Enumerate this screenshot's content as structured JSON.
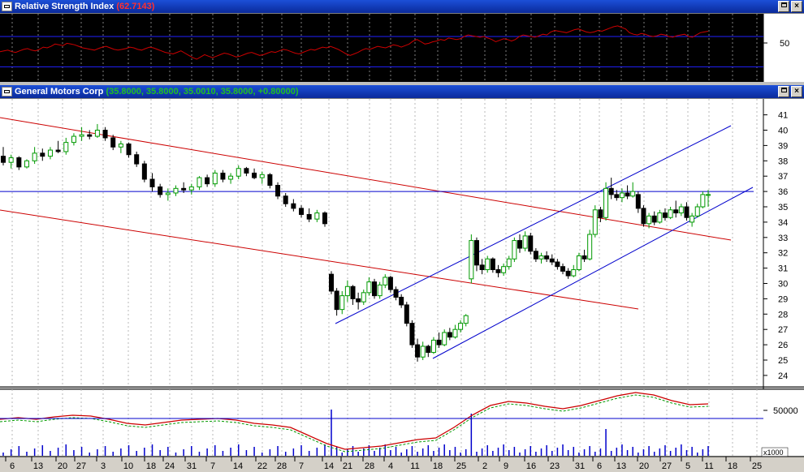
{
  "rsi_window": {
    "title": "Relative Strength Index",
    "value": "(62.7143)",
    "axis_label": "50"
  },
  "price_window": {
    "title": "General Motors Corp",
    "values": "(35.8000, 35.8000, 35.0010, 35.8000, +0.80000)"
  },
  "window_buttons": {
    "restore": "restore",
    "close": "×"
  },
  "price_axis": [
    "41",
    "40",
    "39",
    "38",
    "37",
    "36",
    "35",
    "34",
    "33",
    "32",
    "31",
    "30",
    "29",
    "28",
    "27",
    "26",
    "25",
    "24"
  ],
  "volume_axis": {
    "label": "50000",
    "multiplier": "x1000"
  },
  "date_axis": [
    "6",
    "13",
    "20",
    "27",
    "3",
    "10",
    "18",
    "24",
    "31",
    "7",
    "14",
    "22",
    "28",
    "7",
    "14",
    "21",
    "28",
    "4",
    "11",
    "18",
    "25",
    "2",
    "9",
    "16",
    "23",
    "31",
    "6",
    "13",
    "20",
    "27",
    "5",
    "11",
    "18",
    "25"
  ],
  "colors": {
    "up_candle": "#009900",
    "down_candle": "#000000",
    "channel_red": "#cc0000",
    "channel_blue": "#0000cc",
    "rsi_line": "#cc0000",
    "title_bar": "#0a2a9a"
  },
  "chart_data": {
    "type": "candlestick",
    "ylim": [
      24,
      41
    ],
    "candles": [
      {
        "o": 38.3,
        "h": 38.9,
        "l": 37.7,
        "c": 37.9
      },
      {
        "o": 37.9,
        "h": 38.4,
        "l": 37.5,
        "c": 38.2
      },
      {
        "o": 38.2,
        "h": 38.3,
        "l": 37.4,
        "c": 37.6
      },
      {
        "o": 37.6,
        "h": 38.1,
        "l": 37.5,
        "c": 38.0
      },
      {
        "o": 38.0,
        "h": 38.9,
        "l": 37.8,
        "c": 38.5
      },
      {
        "o": 38.5,
        "h": 38.8,
        "l": 38.0,
        "c": 38.3
      },
      {
        "o": 38.3,
        "h": 38.9,
        "l": 38.1,
        "c": 38.7
      },
      {
        "o": 38.7,
        "h": 39.3,
        "l": 38.5,
        "c": 38.6
      },
      {
        "o": 38.6,
        "h": 39.5,
        "l": 38.4,
        "c": 39.2
      },
      {
        "o": 39.2,
        "h": 39.8,
        "l": 39.0,
        "c": 39.6
      },
      {
        "o": 39.6,
        "h": 40.2,
        "l": 39.3,
        "c": 39.7
      },
      {
        "o": 39.7,
        "h": 40.0,
        "l": 39.4,
        "c": 39.6
      },
      {
        "o": 39.6,
        "h": 40.4,
        "l": 39.5,
        "c": 40.0
      },
      {
        "o": 40.0,
        "h": 40.2,
        "l": 39.3,
        "c": 39.5
      },
      {
        "o": 39.5,
        "h": 39.7,
        "l": 38.7,
        "c": 38.9
      },
      {
        "o": 38.9,
        "h": 39.3,
        "l": 38.5,
        "c": 39.1
      },
      {
        "o": 39.1,
        "h": 39.2,
        "l": 38.2,
        "c": 38.4
      },
      {
        "o": 38.4,
        "h": 38.6,
        "l": 37.6,
        "c": 37.8
      },
      {
        "o": 37.8,
        "h": 38.0,
        "l": 36.6,
        "c": 36.8
      },
      {
        "o": 36.8,
        "h": 37.2,
        "l": 36.0,
        "c": 36.3
      },
      {
        "o": 36.3,
        "h": 36.5,
        "l": 35.6,
        "c": 35.8
      },
      {
        "o": 35.8,
        "h": 36.2,
        "l": 35.4,
        "c": 35.9
      },
      {
        "o": 35.9,
        "h": 36.4,
        "l": 35.7,
        "c": 36.2
      },
      {
        "o": 36.2,
        "h": 36.6,
        "l": 35.9,
        "c": 36.1
      },
      {
        "o": 36.1,
        "h": 36.5,
        "l": 35.8,
        "c": 36.3
      },
      {
        "o": 36.3,
        "h": 37.0,
        "l": 36.1,
        "c": 36.9
      },
      {
        "o": 36.9,
        "h": 37.1,
        "l": 36.3,
        "c": 36.5
      },
      {
        "o": 36.5,
        "h": 37.4,
        "l": 36.3,
        "c": 37.2
      },
      {
        "o": 37.2,
        "h": 37.4,
        "l": 36.6,
        "c": 36.8
      },
      {
        "o": 36.8,
        "h": 37.2,
        "l": 36.5,
        "c": 37.0
      },
      {
        "o": 37.0,
        "h": 37.7,
        "l": 36.8,
        "c": 37.5
      },
      {
        "o": 37.5,
        "h": 37.6,
        "l": 37.0,
        "c": 37.2
      },
      {
        "o": 37.2,
        "h": 37.5,
        "l": 36.8,
        "c": 36.9
      },
      {
        "o": 36.9,
        "h": 37.3,
        "l": 36.5,
        "c": 37.1
      },
      {
        "o": 37.1,
        "h": 37.2,
        "l": 36.2,
        "c": 36.4
      },
      {
        "o": 36.4,
        "h": 36.6,
        "l": 35.5,
        "c": 35.7
      },
      {
        "o": 35.7,
        "h": 35.9,
        "l": 35.0,
        "c": 35.2
      },
      {
        "o": 35.2,
        "h": 35.5,
        "l": 34.7,
        "c": 34.9
      },
      {
        "o": 34.9,
        "h": 35.1,
        "l": 34.3,
        "c": 34.5
      },
      {
        "o": 34.5,
        "h": 34.9,
        "l": 34.0,
        "c": 34.2
      },
      {
        "o": 34.2,
        "h": 34.8,
        "l": 34.0,
        "c": 34.6
      },
      {
        "o": 34.6,
        "h": 34.7,
        "l": 33.7,
        "c": 33.9
      },
      {
        "o": 30.6,
        "h": 30.8,
        "l": 29.3,
        "c": 29.5
      },
      {
        "o": 29.5,
        "h": 29.7,
        "l": 27.9,
        "c": 28.3
      },
      {
        "o": 28.3,
        "h": 29.5,
        "l": 28.0,
        "c": 29.2
      },
      {
        "o": 29.2,
        "h": 30.2,
        "l": 28.8,
        "c": 29.8
      },
      {
        "o": 29.8,
        "h": 29.9,
        "l": 28.6,
        "c": 29.0
      },
      {
        "o": 29.0,
        "h": 29.4,
        "l": 28.3,
        "c": 28.8
      },
      {
        "o": 28.8,
        "h": 29.6,
        "l": 28.6,
        "c": 29.4
      },
      {
        "o": 29.4,
        "h": 30.4,
        "l": 29.2,
        "c": 30.1
      },
      {
        "o": 30.1,
        "h": 30.3,
        "l": 29.0,
        "c": 29.2
      },
      {
        "o": 29.2,
        "h": 30.1,
        "l": 29.0,
        "c": 29.9
      },
      {
        "o": 29.9,
        "h": 30.6,
        "l": 29.7,
        "c": 30.4
      },
      {
        "o": 30.4,
        "h": 30.5,
        "l": 29.4,
        "c": 29.6
      },
      {
        "o": 29.6,
        "h": 29.8,
        "l": 28.9,
        "c": 29.1
      },
      {
        "o": 29.1,
        "h": 29.3,
        "l": 28.4,
        "c": 28.6
      },
      {
        "o": 28.6,
        "h": 28.8,
        "l": 27.2,
        "c": 27.4
      },
      {
        "o": 27.4,
        "h": 27.6,
        "l": 25.8,
        "c": 26.0
      },
      {
        "o": 26.0,
        "h": 26.4,
        "l": 24.9,
        "c": 25.2
      },
      {
        "o": 25.2,
        "h": 26.2,
        "l": 25.0,
        "c": 25.9
      },
      {
        "o": 25.9,
        "h": 26.0,
        "l": 25.2,
        "c": 25.5
      },
      {
        "o": 25.5,
        "h": 26.5,
        "l": 25.4,
        "c": 26.3
      },
      {
        "o": 26.3,
        "h": 26.8,
        "l": 25.8,
        "c": 26.0
      },
      {
        "o": 26.0,
        "h": 27.0,
        "l": 25.9,
        "c": 26.8
      },
      {
        "o": 26.8,
        "h": 27.1,
        "l": 26.3,
        "c": 26.5
      },
      {
        "o": 26.5,
        "h": 27.3,
        "l": 26.4,
        "c": 27.0
      },
      {
        "o": 27.0,
        "h": 27.6,
        "l": 26.8,
        "c": 27.4
      },
      {
        "o": 27.4,
        "h": 28.0,
        "l": 27.2,
        "c": 27.9
      },
      {
        "o": 30.3,
        "h": 33.2,
        "l": 30.0,
        "c": 32.8
      },
      {
        "o": 32.8,
        "h": 33.0,
        "l": 30.8,
        "c": 31.2
      },
      {
        "o": 31.2,
        "h": 31.6,
        "l": 30.6,
        "c": 30.9
      },
      {
        "o": 30.9,
        "h": 31.8,
        "l": 30.7,
        "c": 31.6
      },
      {
        "o": 31.6,
        "h": 31.7,
        "l": 30.7,
        "c": 30.9
      },
      {
        "o": 30.9,
        "h": 31.2,
        "l": 30.4,
        "c": 30.7
      },
      {
        "o": 30.7,
        "h": 31.3,
        "l": 30.5,
        "c": 31.1
      },
      {
        "o": 31.1,
        "h": 31.8,
        "l": 30.9,
        "c": 31.6
      },
      {
        "o": 31.6,
        "h": 33.0,
        "l": 31.4,
        "c": 32.8
      },
      {
        "o": 32.8,
        "h": 33.2,
        "l": 32.0,
        "c": 32.3
      },
      {
        "o": 32.3,
        "h": 33.4,
        "l": 32.1,
        "c": 33.1
      },
      {
        "o": 33.1,
        "h": 33.3,
        "l": 31.9,
        "c": 32.1
      },
      {
        "o": 32.1,
        "h": 32.3,
        "l": 31.4,
        "c": 31.6
      },
      {
        "o": 31.6,
        "h": 32.0,
        "l": 31.3,
        "c": 31.8
      },
      {
        "o": 31.8,
        "h": 32.1,
        "l": 31.4,
        "c": 31.6
      },
      {
        "o": 31.6,
        "h": 31.9,
        "l": 31.2,
        "c": 31.4
      },
      {
        "o": 31.4,
        "h": 31.6,
        "l": 30.9,
        "c": 31.1
      },
      {
        "o": 31.1,
        "h": 31.3,
        "l": 30.6,
        "c": 30.8
      },
      {
        "o": 30.8,
        "h": 31.0,
        "l": 30.3,
        "c": 30.5
      },
      {
        "o": 30.5,
        "h": 31.2,
        "l": 30.4,
        "c": 30.9
      },
      {
        "o": 30.9,
        "h": 32.0,
        "l": 30.8,
        "c": 31.8
      },
      {
        "o": 31.8,
        "h": 32.2,
        "l": 31.4,
        "c": 31.6
      },
      {
        "o": 31.6,
        "h": 33.5,
        "l": 31.5,
        "c": 33.2
      },
      {
        "o": 33.2,
        "h": 35.1,
        "l": 33.0,
        "c": 34.8
      },
      {
        "o": 34.8,
        "h": 35.0,
        "l": 34.0,
        "c": 34.3
      },
      {
        "o": 34.3,
        "h": 36.6,
        "l": 34.1,
        "c": 36.2
      },
      {
        "o": 36.2,
        "h": 36.9,
        "l": 35.5,
        "c": 35.8
      },
      {
        "o": 35.8,
        "h": 36.1,
        "l": 35.4,
        "c": 35.6
      },
      {
        "o": 35.6,
        "h": 36.2,
        "l": 35.3,
        "c": 35.9
      },
      {
        "o": 35.9,
        "h": 36.4,
        "l": 35.5,
        "c": 35.7
      },
      {
        "o": 35.7,
        "h": 36.6,
        "l": 35.6,
        "c": 36.0
      },
      {
        "o": 35.8,
        "h": 36.0,
        "l": 34.6,
        "c": 34.9
      },
      {
        "o": 34.9,
        "h": 35.1,
        "l": 33.7,
        "c": 33.9
      },
      {
        "o": 33.9,
        "h": 34.6,
        "l": 33.6,
        "c": 34.4
      },
      {
        "o": 34.4,
        "h": 34.7,
        "l": 33.8,
        "c": 34.0
      },
      {
        "o": 34.0,
        "h": 34.8,
        "l": 33.9,
        "c": 34.6
      },
      {
        "o": 34.6,
        "h": 34.9,
        "l": 34.1,
        "c": 34.3
      },
      {
        "o": 34.3,
        "h": 35.0,
        "l": 34.2,
        "c": 34.8
      },
      {
        "o": 34.8,
        "h": 35.4,
        "l": 34.3,
        "c": 34.6
      },
      {
        "o": 34.6,
        "h": 35.2,
        "l": 34.4,
        "c": 35.0
      },
      {
        "o": 35.0,
        "h": 35.3,
        "l": 34.1,
        "c": 34.3
      },
      {
        "o": 34.0,
        "h": 34.6,
        "l": 33.7,
        "c": 34.4
      },
      {
        "o": 34.4,
        "h": 35.2,
        "l": 34.3,
        "c": 35.0
      },
      {
        "o": 35.0,
        "h": 36.0,
        "l": 34.9,
        "c": 35.8
      },
      {
        "o": 35.8,
        "h": 36.1,
        "l": 35.0,
        "c": 35.8
      }
    ],
    "horizontal_line": 36.0,
    "rsi_reference_lines": [
      70,
      30
    ],
    "rsi": [
      50,
      51,
      52,
      50,
      49,
      51,
      53,
      54,
      52,
      51,
      53,
      56,
      55,
      57,
      60,
      59,
      58,
      61,
      60,
      59,
      57,
      55,
      54,
      53,
      52,
      54,
      56,
      57,
      55,
      53,
      52,
      53,
      54,
      56,
      55,
      53,
      52,
      54,
      56,
      55,
      53,
      51,
      49,
      48,
      47,
      49,
      51,
      48,
      45,
      42,
      40,
      43,
      46,
      44,
      42,
      44,
      46,
      48,
      47,
      45,
      43,
      44,
      46,
      48,
      49,
      47,
      45,
      46,
      48,
      50,
      49,
      51,
      53,
      52,
      50,
      48,
      47,
      49,
      51,
      53,
      52,
      54,
      56,
      55,
      57,
      55,
      53,
      50,
      47,
      45,
      47,
      49,
      52,
      54,
      53,
      55,
      57,
      56,
      55,
      57,
      59,
      58,
      56,
      58,
      60,
      64,
      66,
      63,
      60,
      61,
      63,
      64,
      66,
      65,
      68,
      67,
      66,
      67,
      70,
      72,
      71,
      70,
      69,
      70,
      68,
      66,
      63,
      65,
      67,
      66,
      64,
      66,
      70,
      72,
      71,
      70,
      69,
      71,
      73,
      72,
      76,
      78,
      77,
      76,
      75,
      77,
      79,
      80,
      78,
      76,
      75,
      76,
      78,
      77,
      79,
      81,
      83,
      84,
      82,
      80,
      75,
      73,
      72,
      74,
      73,
      71,
      70,
      71,
      73,
      72,
      70,
      69,
      71,
      72,
      73,
      70,
      69,
      72,
      75,
      76,
      77
    ],
    "volume_lines": [
      48000,
      50500
    ]
  }
}
